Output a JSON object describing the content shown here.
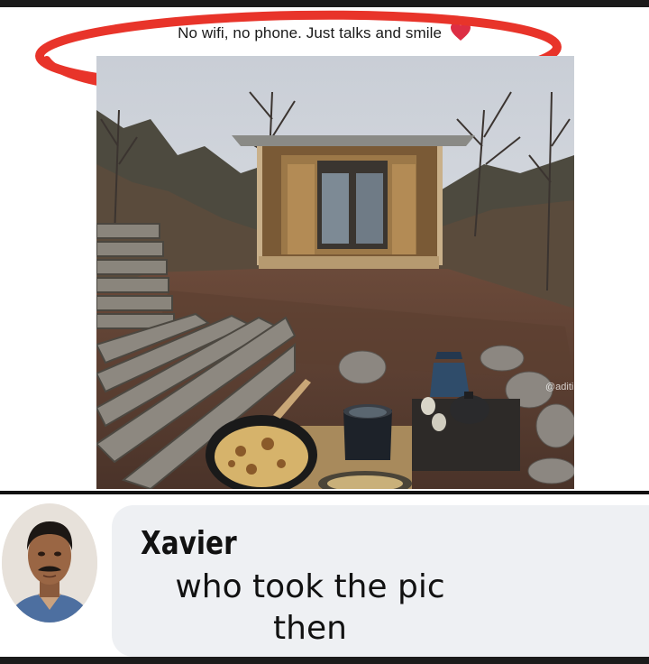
{
  "post": {
    "caption": "No wifi, no phone. Just talks and smile",
    "caption_emoji": "heart-icon",
    "watermark": "@aditi",
    "annotation_color": "#e8342a"
  },
  "comment": {
    "author": "Xavier",
    "text": "who took the pic then",
    "bubble_color": "#eef0f3"
  }
}
